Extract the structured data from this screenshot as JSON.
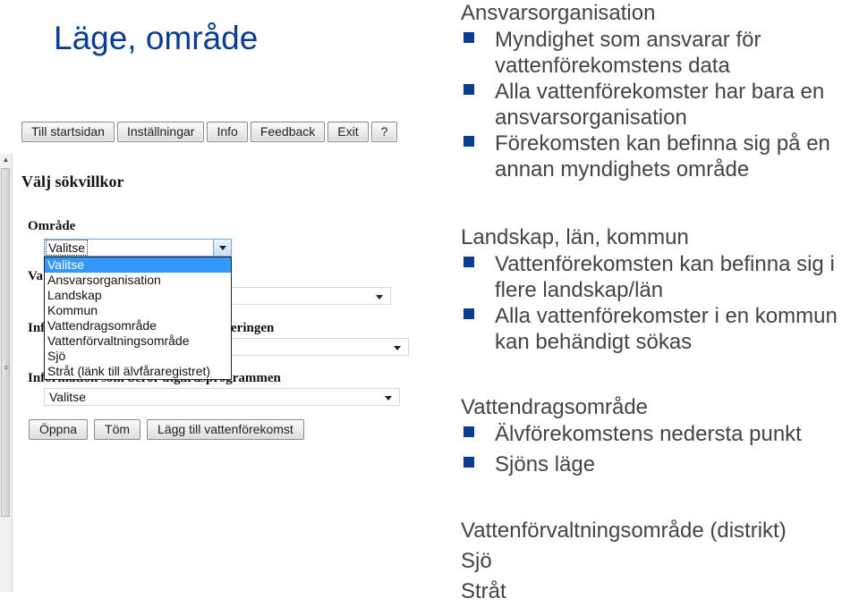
{
  "slide": {
    "title": "Läge, område"
  },
  "app": {
    "toolbar": [
      "Till startsidan",
      "Inställningar",
      "Info",
      "Feedback",
      "Exit",
      "?"
    ],
    "page_heading": "Välj sökvillkor",
    "fields": {
      "omrade": {
        "label": "Område",
        "value": "Valitse"
      },
      "field2": {
        "label": "Va",
        "value": ""
      },
      "field3": {
        "label_left": "Inf",
        "label_right": "eringen",
        "value": ""
      },
      "field4": {
        "label": "Information som beror åtgärdsprogrammen",
        "value": "Valitse"
      }
    },
    "dropdown_options": [
      "Valitse",
      "Ansvarsorganisation",
      "Landskap",
      "Kommun",
      "Vattendragsområde",
      "Vattenförvaltningsområde",
      "Sjö",
      "Stråt (länk till älvfåraregistret)"
    ],
    "dropdown_selected": "Valitse",
    "buttons": [
      "Öppna",
      "Töm",
      "Lägg till vattenförekomst"
    ]
  },
  "notes": {
    "sections": [
      {
        "title": "Ansvarsorganisation",
        "bullets": [
          "Myndighet som ansvarar för vattenförekomstens data",
          "Alla vattenförekomster har bara en ansvarsorganisation",
          "Förekomsten kan befinna sig på en annan myndighets område"
        ]
      },
      {
        "title": "Landskap, län, kommun",
        "bullets": [
          "Vattenförekomsten kan befinna sig i flere landskap/län",
          "Alla vattenförekomster i en kommun kan behändigt sökas"
        ]
      },
      {
        "title": "Vattendragsområde",
        "bullets": [
          "Älvförekomstens nedersta punkt",
          "Sjöns läge"
        ]
      }
    ],
    "plain_lines": [
      "Vattenförvaltningsområde (distrikt)",
      "Sjö",
      "Stråt"
    ]
  },
  "colors": {
    "title": "#0a3d8f",
    "bullet": "#0a3d8f",
    "body_text": "#444444",
    "selection": "#3399ff"
  }
}
